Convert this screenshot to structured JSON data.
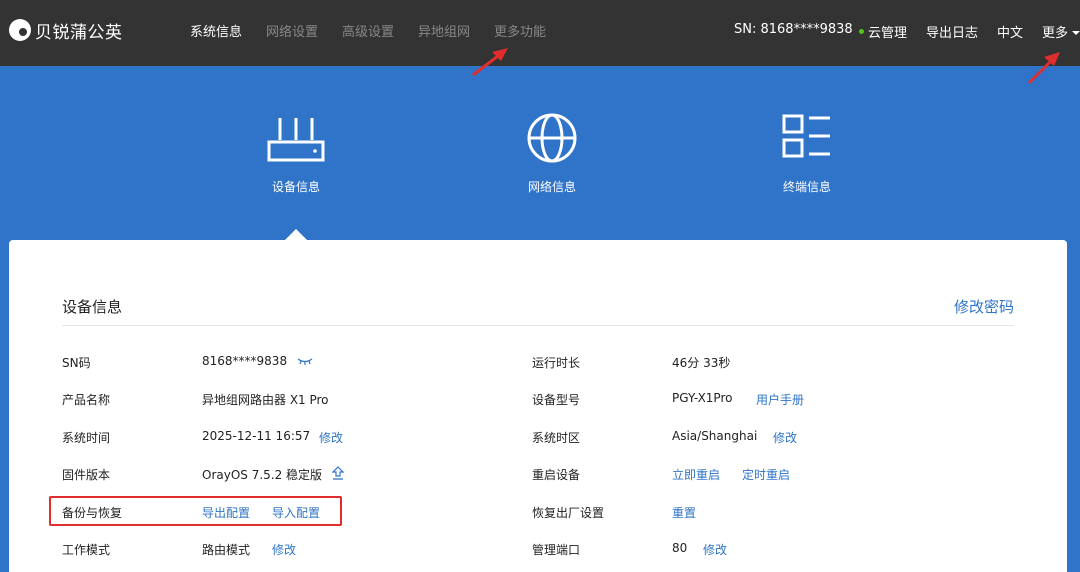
{
  "brand": {
    "name": "贝锐蒲公英"
  },
  "nav": [
    "系统信息",
    "网络设置",
    "高级设置",
    "异地组网",
    "更多功能"
  ],
  "topright": {
    "sn": "SN:  8168****9838",
    "cloud": "云管理",
    "export_log": "导出日志",
    "lang": "中文",
    "more": "更多"
  },
  "tabs": [
    "设备信息",
    "网络信息",
    "终端信息"
  ],
  "card": {
    "title": "设备信息",
    "change_password": "修改密码"
  },
  "left_rows": [
    {
      "label": "SN码",
      "value": "8168****9838"
    },
    {
      "label": "产品名称",
      "value": "异地组网路由器 X1 Pro"
    },
    {
      "label": "系统时间",
      "value": "2025-12-11 16:57",
      "action": "修改"
    },
    {
      "label": "固件版本",
      "value": "OrayOS 7.5.2 稳定版"
    },
    {
      "label": "备份与恢复",
      "action1": "导出配置",
      "action2": "导入配置"
    },
    {
      "label": "工作模式",
      "value": "路由模式",
      "action": "修改"
    }
  ],
  "right_rows": [
    {
      "label": "运行时长",
      "value": "46分 33秒"
    },
    {
      "label": "设备型号",
      "value": "PGY-X1Pro",
      "action": "用户手册"
    },
    {
      "label": "系统时区",
      "value": "Asia/Shanghai",
      "action": "修改"
    },
    {
      "label": "重启设备",
      "action1": "立即重启",
      "action2": "定时重启"
    },
    {
      "label": "恢复出厂设置",
      "action": "重置"
    },
    {
      "label": "管理端口",
      "value": "80",
      "action": "修改"
    }
  ],
  "colors": {
    "topbar": "#333333",
    "accent": "#2f74c9",
    "highlight": "#e02d2d"
  }
}
